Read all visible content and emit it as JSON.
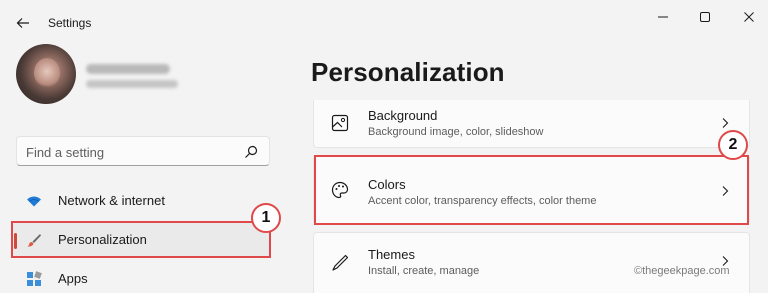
{
  "titlebar": {
    "title": "Settings"
  },
  "profile": {},
  "search": {
    "placeholder": "Find a setting"
  },
  "nav": {
    "items": [
      {
        "label": "Network & internet",
        "icon": "wifi-icon"
      },
      {
        "label": "Personalization",
        "icon": "brush-icon",
        "selected": true
      },
      {
        "label": "Apps",
        "icon": "apps-icon"
      }
    ]
  },
  "main": {
    "title": "Personalization",
    "cards": [
      {
        "title": "Background",
        "subtitle": "Background image, color, slideshow",
        "icon": "image-icon"
      },
      {
        "title": "Colors",
        "subtitle": "Accent color, transparency effects, color theme",
        "icon": "palette-icon"
      },
      {
        "title": "Themes",
        "subtitle": "Install, create, manage",
        "icon": "pen-icon"
      }
    ]
  },
  "annotations": {
    "step1": "1",
    "step2": "2",
    "color": "#e0494a"
  },
  "colors": {
    "accent": "#d04a3c",
    "background": "#f3f3f3",
    "card": "#fbfbfb"
  },
  "watermark": "©thegeekpage.com"
}
